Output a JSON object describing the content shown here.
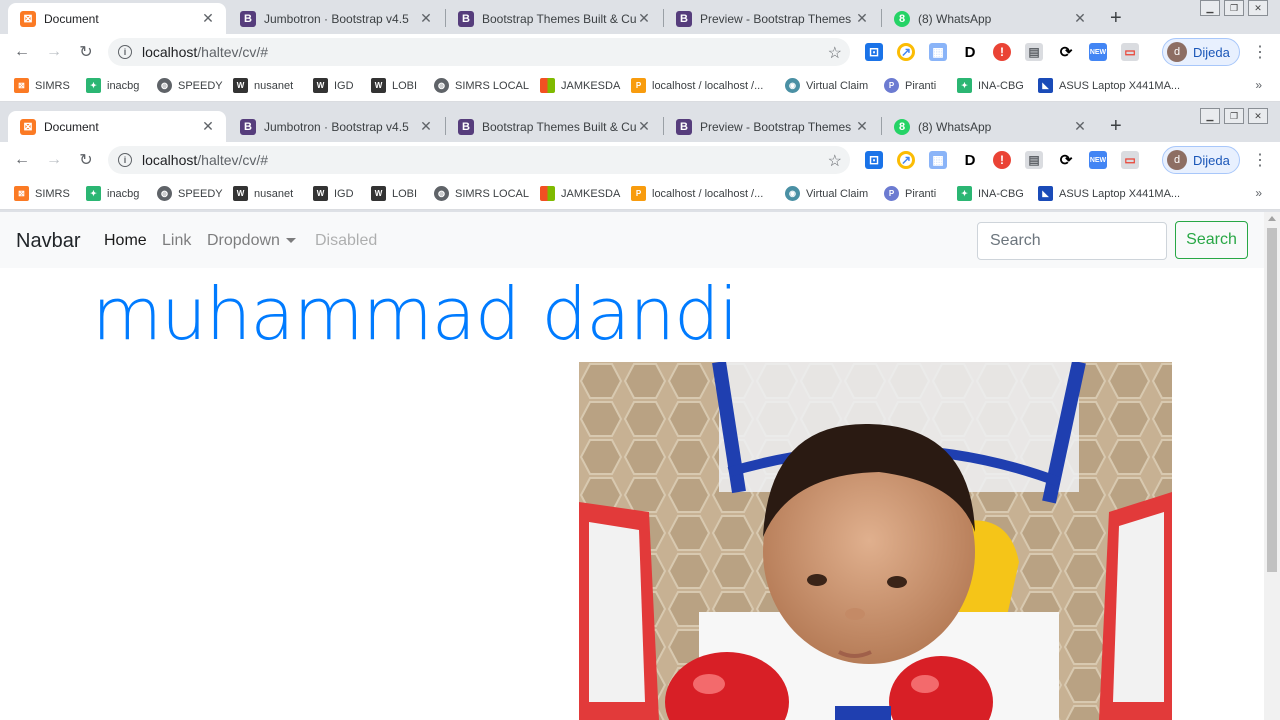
{
  "browser": {
    "tabs": [
      {
        "title": "Document",
        "favicon": "xampp-icon",
        "color": "#fb7a24",
        "glyph": "⊠"
      },
      {
        "title": "Jumbotron · Bootstrap v4.5",
        "favicon": "bootstrap-icon",
        "color": "#563d7c",
        "glyph": "B"
      },
      {
        "title": "Bootstrap Themes Built & Curate",
        "favicon": "bootstrap-icon",
        "color": "#563d7c",
        "glyph": "B"
      },
      {
        "title": "Preview - Bootstrap Themes",
        "favicon": "bootstrap-icon",
        "color": "#563d7c",
        "glyph": "B"
      },
      {
        "title": "(8) WhatsApp",
        "favicon": "whatsapp-icon",
        "color": "#25d366",
        "glyph": "8"
      }
    ],
    "url_host": "localhost",
    "url_path": "/haltev/cv/#",
    "profile_initial": "d",
    "profile_name": "Dijeda",
    "bookmarks": [
      {
        "label": "SIMRS",
        "icon": "xampp-icon",
        "color": "#fb7a24"
      },
      {
        "label": "inacbg",
        "icon": "ina-icon",
        "color": "#2bb673"
      },
      {
        "label": "SPEEDY",
        "icon": "globe-icon",
        "color": "#5f6368"
      },
      {
        "label": "nusanet",
        "icon": "dd-wrt-icon",
        "color": "#333333"
      },
      {
        "label": "IGD",
        "icon": "dd-wrt-icon",
        "color": "#333333"
      },
      {
        "label": "LOBI",
        "icon": "dd-wrt-icon",
        "color": "#333333"
      },
      {
        "label": "SIMRS LOCAL",
        "icon": "globe-icon",
        "color": "#5f6368"
      },
      {
        "label": "JAMKESDA",
        "icon": "windows-icon",
        "color": "#f25022"
      },
      {
        "label": "localhost / localhost /...",
        "icon": "phpmyadmin-icon",
        "color": "#f89c0e"
      },
      {
        "label": "Virtual Claim",
        "icon": "virtual-claim-icon",
        "color": "#4a90a4"
      },
      {
        "label": "Piranti",
        "icon": "piranti-icon",
        "color": "#6c7bd1"
      },
      {
        "label": "INA-CBG",
        "icon": "ina-icon",
        "color": "#2bb673"
      },
      {
        "label": "ASUS Laptop X441MA...",
        "icon": "asus-icon",
        "color": "#1a4bb8"
      }
    ]
  },
  "navbar": {
    "brand": "Navbar",
    "links": [
      {
        "label": "Home",
        "state": "active"
      },
      {
        "label": "Link",
        "state": "normal"
      },
      {
        "label": "Dropdown",
        "state": "dropdown"
      },
      {
        "label": "Disabled",
        "state": "disabled"
      }
    ],
    "search_placeholder": "Search",
    "search_button": "Search"
  },
  "main": {
    "heading": "muhammad dandi",
    "photo": "baby-in-walker-photo"
  },
  "colors": {
    "heading": "#007bff",
    "search_button": "#28a745",
    "navbar_bg": "#f8f9fa"
  }
}
